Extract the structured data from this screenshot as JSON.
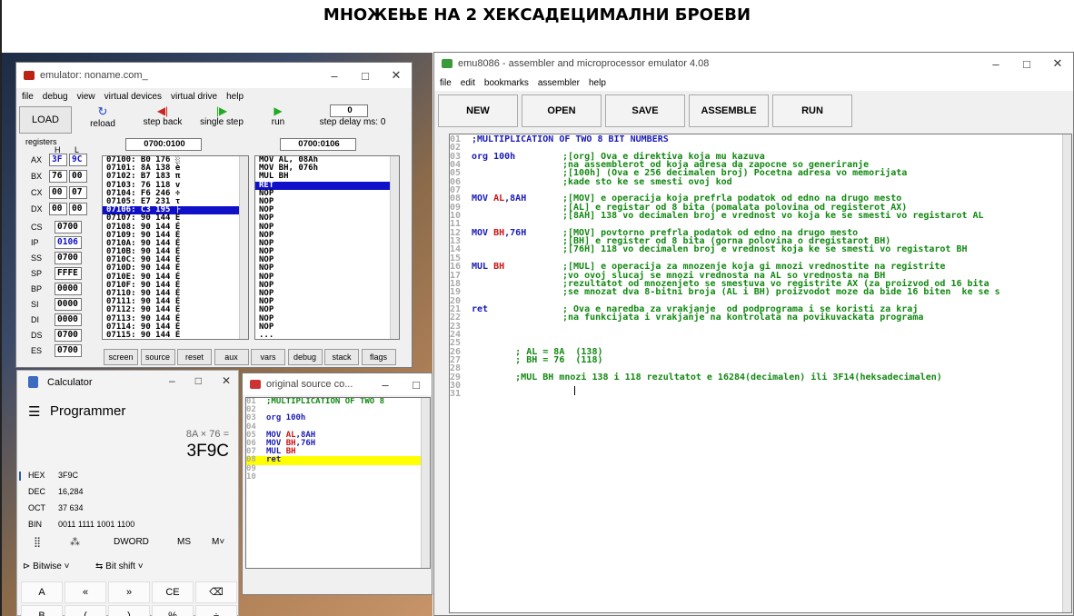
{
  "title": "МНОЖЕЊЕ НА 2 ХЕКСАДЕЦИМАЛНИ БРОЕВИ",
  "emu": {
    "title": "emulator: noname.com_",
    "menu": [
      "file",
      "debug",
      "view",
      "virtual devices",
      "virtual drive",
      "help"
    ],
    "load": "LOAD",
    "reload": "reload",
    "step_back": "step back",
    "single_step": "single step",
    "run": "run",
    "delay_value": "0",
    "delay_label": "step delay ms: 0",
    "registers_label": "registers",
    "h": "H",
    "l": "L",
    "regs": [
      {
        "n": "AX",
        "h": "3F",
        "l": "9C"
      },
      {
        "n": "BX",
        "h": "76",
        "l": "00"
      },
      {
        "n": "CX",
        "h": "00",
        "l": "07"
      },
      {
        "n": "DX",
        "h": "00",
        "l": "00"
      }
    ],
    "seg": [
      {
        "n": "CS",
        "v": "0700"
      },
      {
        "n": "IP",
        "v": "0106"
      },
      {
        "n": "SS",
        "v": "0700"
      },
      {
        "n": "SP",
        "v": "FFFE"
      },
      {
        "n": "BP",
        "v": "0000"
      },
      {
        "n": "SI",
        "v": "0000"
      },
      {
        "n": "DI",
        "v": "0000"
      },
      {
        "n": "DS",
        "v": "0700"
      },
      {
        "n": "ES",
        "v": "0700"
      }
    ],
    "addr1": "0700:0100",
    "addr2": "0700:0106",
    "mem": [
      "07100: B0 176 ░",
      "07101: 8A 138 è",
      "07102: B7 183 π",
      "07103: 76 118 v",
      "07104: F6 246 ÷",
      "07105: E7 231 τ",
      "07106: C3 195 ├",
      "07107: 90 144 É",
      "07108: 90 144 É",
      "07109: 90 144 É",
      "0710A: 90 144 É",
      "0710B: 90 144 É",
      "0710C: 90 144 É",
      "0710D: 90 144 É",
      "0710E: 90 144 É",
      "0710F: 90 144 É",
      "07110: 90 144 É",
      "07111: 90 144 É",
      "07112: 90 144 É",
      "07113: 90 144 É",
      "07114: 90 144 É",
      "07115: 90 144 É"
    ],
    "dis": [
      "MOV AL, 08Ah",
      "MOV BH, 076h",
      "MUL BH",
      "RET",
      "NOP",
      "NOP",
      "NOP",
      "NOP",
      "NOP",
      "NOP",
      "NOP",
      "NOP",
      "NOP",
      "NOP",
      "NOP",
      "NOP",
      "NOP",
      "NOP",
      "NOP",
      "NOP",
      "NOP",
      "..."
    ],
    "bottom": [
      "screen",
      "source",
      "reset",
      "aux",
      "vars",
      "debug",
      "stack",
      "flags"
    ]
  },
  "calc": {
    "app": "Calculator",
    "mode": "Programmer",
    "expr": "8A × 76 =",
    "result": "3F9C",
    "rows": [
      {
        "k": "HEX",
        "v": "3F9C"
      },
      {
        "k": "DEC",
        "v": "16,284"
      },
      {
        "k": "OCT",
        "v": "37 634"
      },
      {
        "k": "BIN",
        "v": "0011 1111 1001 1100"
      }
    ],
    "word": "DWORD",
    "ms": "MS",
    "mv": "M˅",
    "bitwise": "Bitwise",
    "bitshift": "Bit shift",
    "keys": [
      "A",
      "«",
      "»",
      "CE",
      "⌫"
    ],
    "keys2": [
      "B",
      "(",
      ")",
      "%",
      "÷"
    ]
  },
  "src": {
    "title": "original source co...",
    "lines": [
      {
        "n": "01",
        "t": ";MULTIPLICATION OF TWO 8"
      },
      {
        "n": "02",
        "t": ""
      },
      {
        "n": "03",
        "t": "org 100h"
      },
      {
        "n": "04",
        "t": ""
      },
      {
        "n": "05",
        "a": "MOV ",
        "b": "AL",
        ",c": ",8AH"
      },
      {
        "n": "06",
        "a": "MOV ",
        "b": "BH",
        ",c": ",76H"
      },
      {
        "n": "07",
        "a": "MUL ",
        "b": "BH"
      },
      {
        "n": "08",
        "t": "ret"
      },
      {
        "n": "09",
        "t": ""
      },
      {
        "n": "10",
        "t": ""
      }
    ]
  },
  "main": {
    "title": "emu8086 - assembler and microprocessor emulator 4.08",
    "menu": [
      "file",
      "edit",
      "bookmarks",
      "assembler",
      "help"
    ],
    "buttons": [
      "NEW",
      "OPEN",
      "SAVE",
      "ASSEMBLE",
      "RUN"
    ],
    "code": [
      {
        "n": "01",
        "c": ";MULTIPLICATION OF TWO 8 BIT NUMBERS",
        "k": "cmt"
      },
      {
        "n": "02"
      },
      {
        "n": "03",
        "i": "org 100h",
        "c": ";[org] Ova e direktiva koja mu kazuva"
      },
      {
        "n": "04",
        "c": ";na assemblerot od koja adresa da zapocne so generiranje"
      },
      {
        "n": "05",
        "c": ";[100h] (Ova e 256 decimalen broj) Pocetna adresa vo memorijata"
      },
      {
        "n": "06",
        "c": ";kade sto ke se smesti ovoj kod"
      },
      {
        "n": "07"
      },
      {
        "n": "08",
        "o": "MOV ",
        "r": "AL",
        "x": ",8AH",
        "c": ";[MOV] e operacija koja prefrla podatok od edno na drugo mesto"
      },
      {
        "n": "09",
        "c": ";[AL] e registar od 8 bita (pomalata polovina od registerot AX)"
      },
      {
        "n": "10",
        "c": ";[8AH] 138 vo decimalen broj e vrednost vo koja ke se smesti vo registarot AL"
      },
      {
        "n": "11"
      },
      {
        "n": "12",
        "o": "MOV ",
        "r": "BH",
        "x": ",76H",
        "c": ";[MOV] povtorno prefrla podatok od edno na drugo mesto"
      },
      {
        "n": "13",
        "c": ";[BH] e register od 8 bita (gorna polovina o dregistarot BH)"
      },
      {
        "n": "14",
        "c": ";[76H] 118 vo decimalen broj e vrednost koja ke se smesti vo registarot BH"
      },
      {
        "n": "15"
      },
      {
        "n": "16",
        "o": "MUL ",
        "r": "BH",
        "c": ";[MUL] e operacija za mnozenje koja gi mnozi vrednostite na registrite"
      },
      {
        "n": "17",
        "c": ";vo ovoj slucaj se mnozi vrednosta na AL so vrednosta na BH"
      },
      {
        "n": "18",
        "c": ";rezultatot od mnozenjeto se smestuva vo registrite AX (za proizvod od 16 bita"
      },
      {
        "n": "19",
        "c": ";se mnozat dva 8-bitni broja (AL i BH) proizvodot moze da bide 16 biten  ke se s"
      },
      {
        "n": "20"
      },
      {
        "n": "21",
        "i": "ret",
        "c": "; Ova e naredba za vrakjanje  od podprograma i se koristi za kraj"
      },
      {
        "n": "22",
        "c": ";na funkcijata i vrakjanje na kontrolata na povikuvackata programa"
      },
      {
        "n": "23"
      },
      {
        "n": "24"
      },
      {
        "n": "25"
      },
      {
        "n": "26",
        "c2": "        ; AL = 8A  (138)"
      },
      {
        "n": "27",
        "c2": "        ; BH = 76  (118)"
      },
      {
        "n": "28"
      },
      {
        "n": "29",
        "c2": "        ;MUL BH mnozi 138 i 118 rezultatot e 16284(decimalen) ili 3F14(heksadecimalen)"
      },
      {
        "n": "30"
      },
      {
        "n": "31"
      }
    ]
  }
}
